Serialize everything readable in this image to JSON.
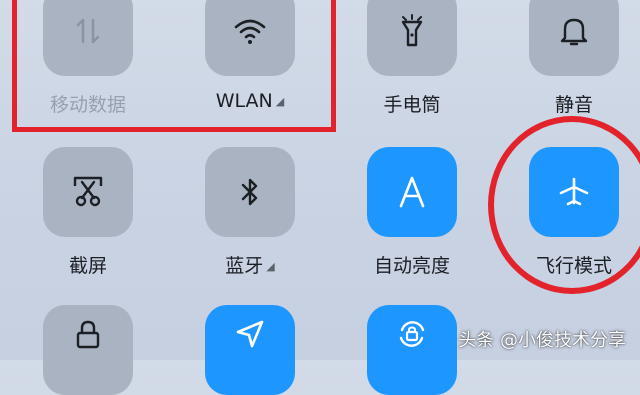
{
  "tiles": {
    "mobile_data": {
      "label": "移动数据",
      "icon": "mobile-data-icon",
      "state": "off"
    },
    "wlan": {
      "label": "WLAN",
      "icon": "wifi-icon",
      "state": "off"
    },
    "flashlight": {
      "label": "手电筒",
      "icon": "flashlight-icon",
      "state": "off"
    },
    "mute": {
      "label": "静音",
      "icon": "bell-icon",
      "state": "off"
    },
    "screenshot": {
      "label": "截屏",
      "icon": "screenshot-scissors-icon",
      "state": "off"
    },
    "bluetooth": {
      "label": "蓝牙",
      "icon": "bluetooth-icon",
      "state": "off"
    },
    "auto_brightness": {
      "label": "自动亮度",
      "icon": "brightness-a-icon",
      "state": "on"
    },
    "airplane_mode": {
      "label": "飞行模式",
      "icon": "airplane-icon",
      "state": "on"
    },
    "lock": {
      "icon": "lock-icon",
      "state": "off"
    },
    "location": {
      "icon": "location-arrow-icon",
      "state": "on"
    },
    "rotation_lock": {
      "icon": "rotation-lock-icon",
      "state": "on"
    }
  },
  "colors": {
    "active": "#1e96ff",
    "inactive": "#a9b3c2",
    "annotation": "#e3232c"
  },
  "watermark": "头条 @小俊技术分享"
}
